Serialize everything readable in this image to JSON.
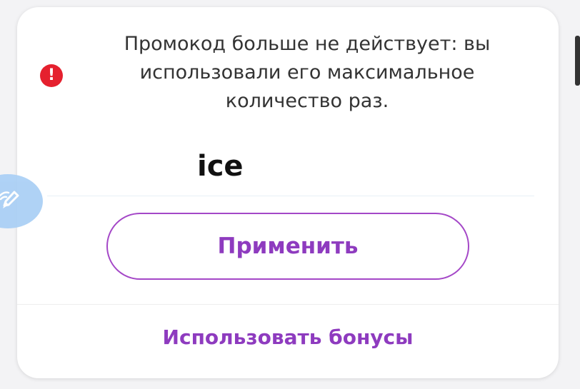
{
  "promo_modal": {
    "error_icon": "exclamation-icon",
    "error_message": "Промокод больше не действует: вы использовали его максимальное количество раз.",
    "promo_code_value": "ice",
    "apply_button_label": "Применить",
    "bonus_link_label": "Использовать бонусы"
  },
  "overlay": {
    "edit_fab_icon": "pencil-icon"
  },
  "colors": {
    "accent": "#8e3bbf",
    "error": "#e5202e",
    "fab": "#a9cff5"
  }
}
